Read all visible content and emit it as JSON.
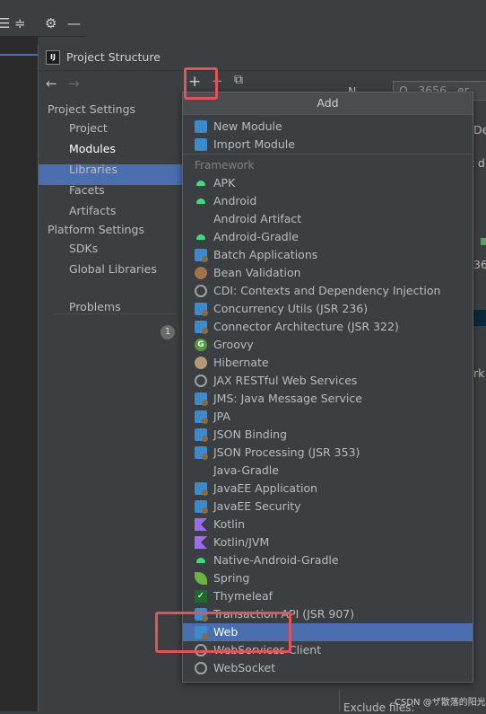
{
  "dialog": {
    "title": "Project Structure",
    "app_icon_text": "IJ"
  },
  "ide_toolbar": {
    "icons": [
      "collapse-icon",
      "expand-icon",
      "gear-icon",
      "minimize-icon"
    ]
  },
  "nav": {
    "project_settings": "Project Settings",
    "project": "Project",
    "modules": "Modules",
    "libraries": "Libraries",
    "facets": "Facets",
    "artifacts": "Artifacts",
    "platform_settings": "Platform Settings",
    "sdks": "SDKs",
    "global_libraries": "Global Libraries",
    "problems": "Problems",
    "problems_count": "1"
  },
  "toolbar": {
    "add": "+",
    "remove": "−",
    "copy": "⧉",
    "back": "←",
    "forward": "→"
  },
  "right_fragments": {
    "name_label": "N",
    "name_value": "O...3656...er",
    "de": "De",
    "t_d": "t d",
    "num": "36",
    "rk": "rk",
    "exclude": "Exclude files:"
  },
  "popup": {
    "title": "Add",
    "new_module": "New Module",
    "import_module": "Import Module",
    "framework_label": "Framework",
    "frameworks": [
      "APK",
      "Android",
      "Android Artifact",
      "Android-Gradle",
      "Batch Applications",
      "Bean Validation",
      "CDI: Contexts and Dependency Injection",
      "Concurrency Utils (JSR 236)",
      "Connector Architecture (JSR 322)",
      "Groovy",
      "Hibernate",
      "JAX RESTful Web Services",
      "JMS: Java Message Service",
      "JPA",
      "JSON Binding",
      "JSON Processing (JSR 353)",
      "Java-Gradle",
      "JavaEE Application",
      "JavaEE Security",
      "Kotlin",
      "Kotlin/JVM",
      "Native-Android-Gradle",
      "Spring",
      "Thymeleaf",
      "Transaction API (JSR 907)",
      "Web",
      "WebServices Client",
      "WebSocket"
    ],
    "selected": "Web"
  },
  "watermark": "CSDN @ザ散落的阳光",
  "colors": {
    "selection": "#4b6eaf",
    "highlight": "#e8505a",
    "background": "#3c3f41"
  }
}
